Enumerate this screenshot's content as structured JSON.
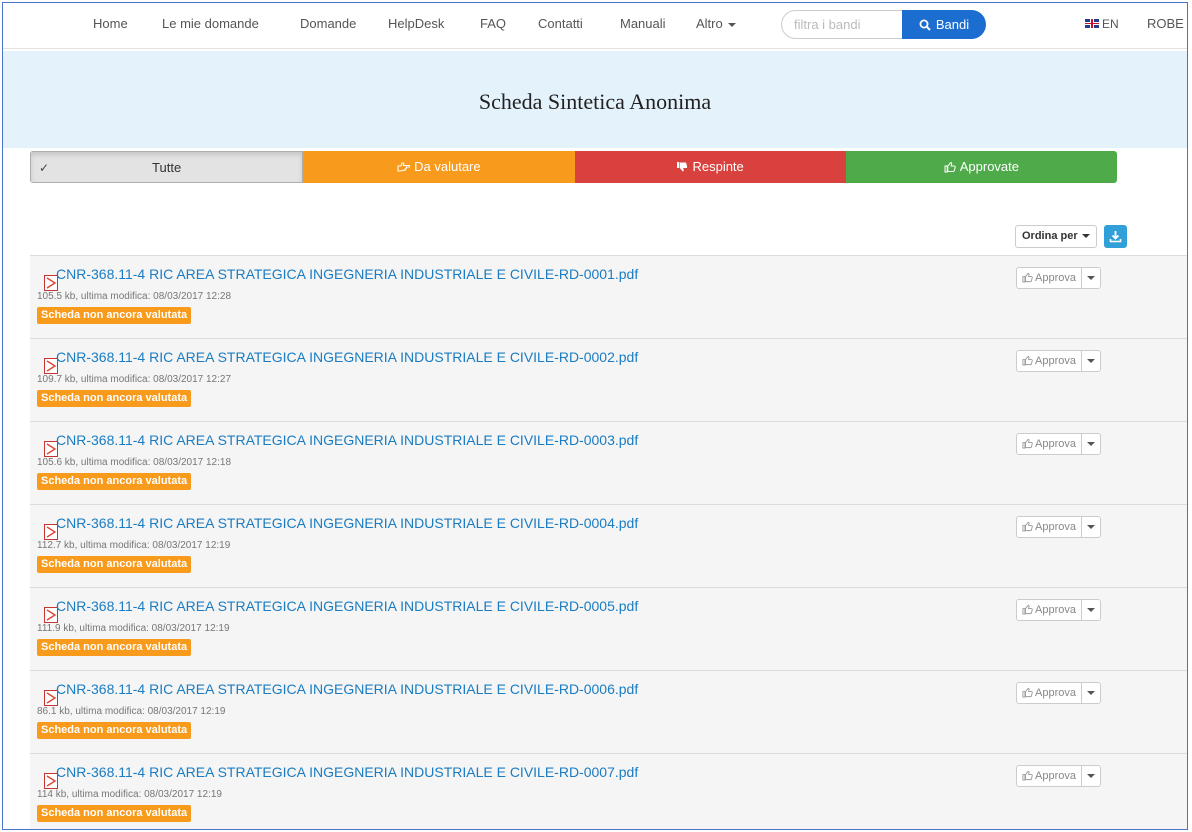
{
  "nav": {
    "items": [
      "Home",
      "Le mie domande",
      "Domande",
      "HelpDesk",
      "FAQ",
      "Contatti",
      "Manuali",
      "Altro"
    ],
    "search_placeholder": "filtra i bandi",
    "search_button": "Bandi",
    "lang": "EN",
    "user": "ROBE"
  },
  "header": {
    "title": "Scheda Sintetica Anonima"
  },
  "filters": {
    "all": "Tutte",
    "to_evaluate": "Da valutare",
    "rejected": "Respinte",
    "approved": "Approvate"
  },
  "toolbar": {
    "sort_label": "Ordina per"
  },
  "files": [
    {
      "name": "CNR-368.11-4 RIC AREA STRATEGICA INGEGNERIA INDUSTRIALE E CIVILE-RD-0001.pdf",
      "meta": "105.5 kb, ultima modifica: 08/03/2017 12:28",
      "status": "Scheda non ancora valutata",
      "action": "Approva"
    },
    {
      "name": "CNR-368.11-4 RIC AREA STRATEGICA INGEGNERIA INDUSTRIALE E CIVILE-RD-0002.pdf",
      "meta": "109.7 kb, ultima modifica: 08/03/2017 12:27",
      "status": "Scheda non ancora valutata",
      "action": "Approva"
    },
    {
      "name": "CNR-368.11-4 RIC AREA STRATEGICA INGEGNERIA INDUSTRIALE E CIVILE-RD-0003.pdf",
      "meta": "105.6 kb, ultima modifica: 08/03/2017 12:18",
      "status": "Scheda non ancora valutata",
      "action": "Approva"
    },
    {
      "name": "CNR-368.11-4 RIC AREA STRATEGICA INGEGNERIA INDUSTRIALE E CIVILE-RD-0004.pdf",
      "meta": "112.7 kb, ultima modifica: 08/03/2017 12:19",
      "status": "Scheda non ancora valutata",
      "action": "Approva"
    },
    {
      "name": "CNR-368.11-4 RIC AREA STRATEGICA INGEGNERIA INDUSTRIALE E CIVILE-RD-0005.pdf",
      "meta": "111.9 kb, ultima modifica: 08/03/2017 12:19",
      "status": "Scheda non ancora valutata",
      "action": "Approva"
    },
    {
      "name": "CNR-368.11-4 RIC AREA STRATEGICA INGEGNERIA INDUSTRIALE E CIVILE-RD-0006.pdf",
      "meta": "86.1 kb, ultima modifica: 08/03/2017 12:19",
      "status": "Scheda non ancora valutata",
      "action": "Approva"
    },
    {
      "name": "CNR-368.11-4 RIC AREA STRATEGICA INGEGNERIA INDUSTRIALE E CIVILE-RD-0007.pdf",
      "meta": "114 kb, ultima modifica: 08/03/2017 12:19",
      "status": "Scheda non ancora valutata",
      "action": "Approva"
    }
  ],
  "colors": {
    "accent": "#1c6dd0",
    "link": "#1a7cc2",
    "warning": "#f89a1c",
    "danger": "#d9413e",
    "success": "#4fab4a",
    "header_bg": "#e4f2fb"
  },
  "icons": {
    "search": "search-icon",
    "to_evaluate": "hand-point-right-icon",
    "rejected": "thumbs-down-icon",
    "approved": "thumbs-up-icon",
    "download": "download-icon",
    "file": "pdf-file-icon",
    "check": "check-icon"
  }
}
